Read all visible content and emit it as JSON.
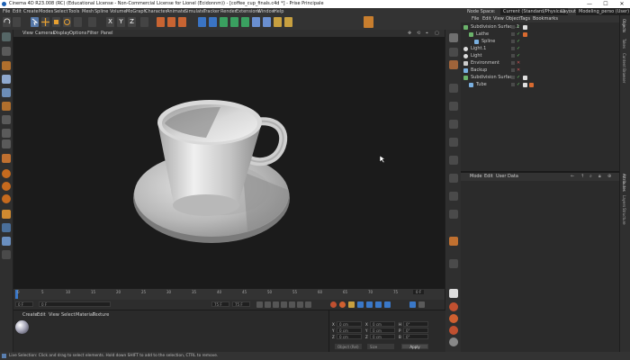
{
  "window": {
    "title": "Cinema 4D R23.008 (RC) (Educational License - Non-Commercial License for Lionel (Ecidonnm)) - [coffee_cup_finals.c4d *] - Prise Principale",
    "controls": [
      "—",
      "☐",
      "✕"
    ]
  },
  "menubar": [
    "File",
    "Edit",
    "Create",
    "Modes",
    "Select",
    "Tools",
    "Mesh",
    "Spline",
    "Volume",
    "MoGraph",
    "Character",
    "Animate",
    "Simulate",
    "Tracker",
    "Render",
    "Extensions",
    "Window",
    "Help"
  ],
  "right_header": {
    "node_space_label": "Node Space:",
    "node_space_value": "Current (Standard/Physical)",
    "layout_label": "Layout:",
    "layout_value": "Modeling_perso (User)"
  },
  "toolbar_coord_letters": [
    "X",
    "Y",
    "Z"
  ],
  "viewport": {
    "menu": [
      "View",
      "Cameras",
      "Display",
      "Options",
      "Filter",
      "Panel"
    ]
  },
  "timeline": {
    "ticks": [
      "0",
      "5",
      "10",
      "15",
      "20",
      "25",
      "30",
      "35",
      "40",
      "45",
      "50",
      "55",
      "60",
      "65",
      "70",
      "75"
    ],
    "end_frame": "0 F"
  },
  "transport": {
    "start_field": "0 F",
    "current_field": "0 F",
    "end_field1": "75 F",
    "end_field2": "75 F"
  },
  "material_manager": {
    "menu": [
      "Create",
      "Edit",
      "View",
      "Select",
      "Material",
      "Texture"
    ]
  },
  "coordinates": {
    "labels": [
      "X",
      "Y",
      "Z"
    ],
    "pos_values": [
      "0 cm",
      "0 cm",
      "0 cm"
    ],
    "size_values": [
      "0 cm",
      "0 cm",
      "0 cm"
    ],
    "rot_labels": [
      "H",
      "P",
      "B"
    ],
    "rot_values": [
      "0°",
      "0°",
      "0°"
    ],
    "mode_dropdown": "Object (Rel)",
    "size_dropdown": "Size",
    "apply_label": "Apply"
  },
  "object_manager": {
    "menu": [
      "File",
      "Edit",
      "View",
      "Object",
      "Tags",
      "Bookmarks"
    ],
    "objects": [
      {
        "name": "Subdivision Surface.1",
        "indent": 0,
        "color": "#6bb36b"
      },
      {
        "name": "Lathe",
        "indent": 1,
        "color": "#6bb36b"
      },
      {
        "name": "Spline",
        "indent": 2,
        "color": "#7ab0e0"
      },
      {
        "name": "Light.1",
        "indent": 0,
        "color": "#dddddd"
      },
      {
        "name": "Light",
        "indent": 0,
        "color": "#dddddd"
      },
      {
        "name": "Environment",
        "indent": 0,
        "color": "#cccccc"
      },
      {
        "name": "Backup",
        "indent": 0,
        "color": "#7ab0e0"
      },
      {
        "name": "Subdivision Surface",
        "indent": 0,
        "color": "#6bb36b"
      },
      {
        "name": "Tube",
        "indent": 1,
        "color": "#7ab0e0"
      }
    ]
  },
  "attribute_manager": {
    "menu": [
      "Mode",
      "Edit",
      "User Data"
    ]
  },
  "right_vertical_tabs": [
    "Objects",
    "Takes",
    "Content Browser",
    "Attributes",
    "Layers",
    "Structure"
  ],
  "statusbar": {
    "text": "Live Selection: Click and drag to select elements. Hold down SHIFT to add to the selection, CTRL to remove."
  }
}
